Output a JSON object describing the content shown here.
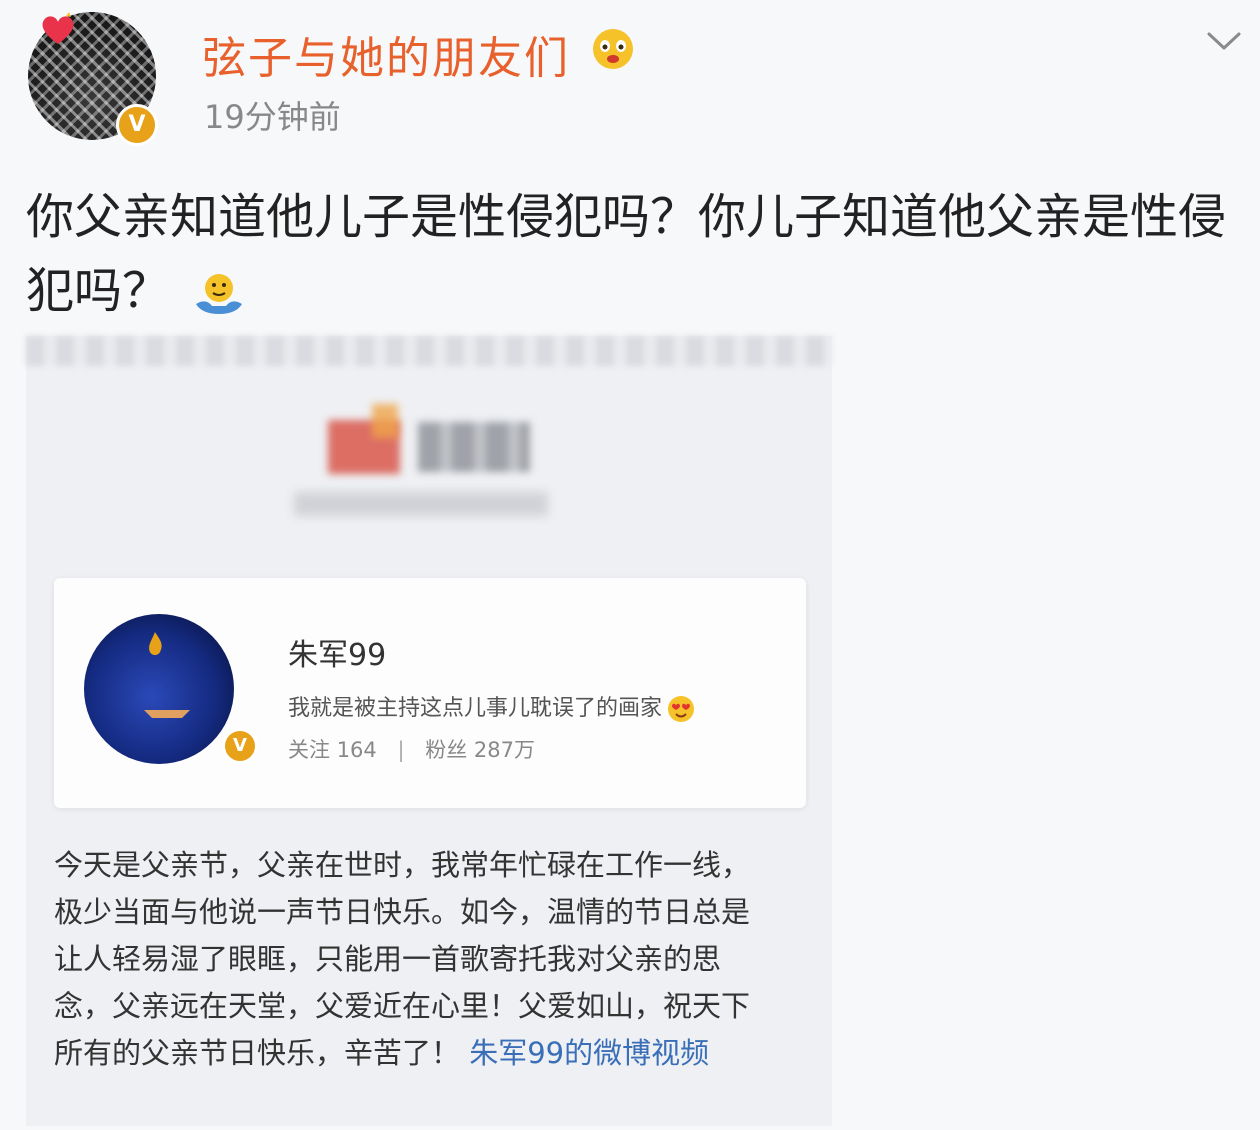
{
  "post": {
    "username": "弦子与她的朋友们",
    "time": "19分钟前",
    "text": "你父亲知道他儿子是性侵犯吗？你儿子知道他父亲是性侵犯吗？",
    "icons": {
      "avatar_decoration": "heart-icon",
      "verified": "verified-badge-icon",
      "username_emoji": "crying-emoji-icon",
      "menu": "chevron-down-icon",
      "text_emoji": "shrug-emoji-icon"
    }
  },
  "screenshot": {
    "profile_card": {
      "name": "朱军99",
      "bio": "我就是被主持这点儿事儿耽误了的画家",
      "following_label": "关注",
      "following_count": "164",
      "followers_label": "粉丝",
      "followers_count": "287万"
    },
    "caption": {
      "text": "今天是父亲节，父亲在世时，我常年忙碌在工作一线，极少当面与他说一声节日快乐。如今，温情的节日总是让人轻易湿了眼眶，只能用一首歌寄托我对父亲的思念，父亲远在天堂，父爱近在心里！父爱如山，祝天下所有的父亲节日快乐，辛苦了！",
      "video_link": "朱军99的微博视频"
    }
  },
  "colors": {
    "username": "#e8602c",
    "verified_badge": "#e8a21a",
    "link": "#3a6fb8",
    "background": "#f7f8fa"
  }
}
